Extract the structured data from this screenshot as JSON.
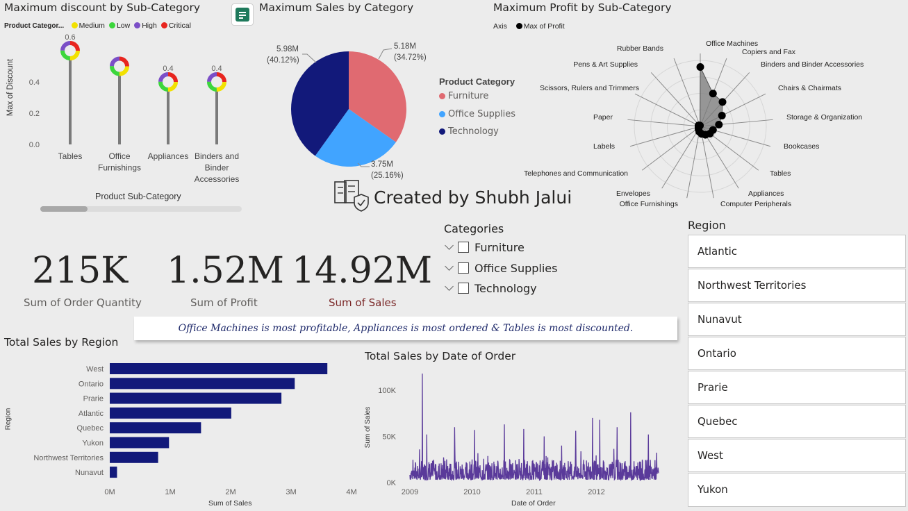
{
  "discount_chart": {
    "title": "Maximum discount by Sub-Category",
    "legend_title": "Product Categor...",
    "legend": [
      {
        "label": "Medium",
        "color": "#f2e100"
      },
      {
        "label": "Low",
        "color": "#3cd63c"
      },
      {
        "label": "High",
        "color": "#7b4fc7"
      },
      {
        "label": "Critical",
        "color": "#e8251f"
      }
    ],
    "ylabel": "Max of Discount",
    "xlabel": "Product Sub-Category",
    "yticks": [
      "0.0",
      "0.2",
      "0.4"
    ]
  },
  "sales_category_chart": {
    "title": "Maximum Sales by Category",
    "legend_title": "Product Category",
    "slice_labels": [
      {
        "value": "5.18M",
        "pct": "(34.72%)"
      },
      {
        "value": "3.75M",
        "pct": "(25.16%)"
      },
      {
        "value": "5.98M",
        "pct": "(40.12%)"
      }
    ]
  },
  "profit_chart": {
    "title": "Maximum Profit by Sub-Category",
    "legend_axis": "Axis",
    "legend_series": "Max of Profit"
  },
  "credit": {
    "text": "Created by Shubh Jalui"
  },
  "kpis": [
    {
      "value": "215K",
      "label": "Sum of Order Quantity"
    },
    {
      "value": "1.52M",
      "label": "Sum of Profit"
    },
    {
      "value": "14.92M",
      "label": "Sum of Sales"
    }
  ],
  "categories_slicer": {
    "title": "Categories",
    "items": [
      "Furniture",
      "Office Supplies",
      "Technology"
    ]
  },
  "region_slicer": {
    "title": "Region",
    "items": [
      "Atlantic",
      "Northwest Territories",
      "Nunavut",
      "Ontario",
      "Prarie",
      "Quebec",
      "West",
      "Yukon"
    ]
  },
  "insight": {
    "text": "Office Machines is most profitable, Appliances is most ordered & Tables is most discounted."
  },
  "region_chart": {
    "title": "Total Sales by Region",
    "xlabel": "Sum of Sales",
    "ylabel": "Region",
    "xticks": [
      "0M",
      "1M",
      "2M",
      "3M",
      "4M"
    ]
  },
  "date_chart": {
    "title": "Total Sales by Date of Order",
    "xlabel": "Date of Order",
    "ylabel": "Sum of Sales",
    "xticks": [
      "2009",
      "2010",
      "2011",
      "2012"
    ],
    "yticks": [
      "0K",
      "50K",
      "100K"
    ]
  },
  "chart_data": [
    {
      "type": "lollipop",
      "title": "Maximum discount by Sub-Category",
      "categories": [
        "Tables",
        "Office Furnishings",
        "Appliances",
        "Binders and Binder Accessories"
      ],
      "values": [
        0.6,
        0.5,
        0.4,
        0.4
      ],
      "data_labels": [
        "0.6",
        "",
        "0.4",
        "0.4"
      ],
      "ylim": [
        0,
        0.6
      ],
      "legend": [
        "Medium",
        "Low",
        "High",
        "Critical"
      ],
      "xlabel": "Product Sub-Category",
      "ylabel": "Max of Discount"
    },
    {
      "type": "pie",
      "title": "Maximum Sales by Category",
      "categories": [
        "Furniture",
        "Office Supplies",
        "Technology"
      ],
      "values": [
        5.18,
        3.75,
        5.98
      ],
      "percentages": [
        34.72,
        25.16,
        40.12
      ],
      "colors": [
        "#e06a71",
        "#41a4ff",
        "#12197a"
      ],
      "legend_title": "Product Category"
    },
    {
      "type": "radar",
      "title": "Maximum Profit by Sub-Category",
      "categories": [
        "Office Machines",
        "Copiers and Fax",
        "Binders and Binder Accessories",
        "Chairs & Chairmats",
        "Storage & Organization",
        "Bookcases",
        "Tables",
        "Appliances",
        "Computer Peripherals",
        "Office Furnishings",
        "Envelopes",
        "Telephones and Communication",
        "Labels",
        "Paper",
        "Scissors, Rulers and Trimmers",
        "Pens & Art Supplies",
        "Rubber Bands"
      ],
      "values": [
        27000,
        16000,
        15000,
        11000,
        8500,
        6000,
        5500,
        4500,
        3500,
        2500,
        1500,
        1000,
        700,
        800,
        900,
        600,
        400
      ],
      "series": "Max of Profit"
    },
    {
      "type": "bar",
      "orientation": "horizontal",
      "title": "Total Sales by Region",
      "categories": [
        "West",
        "Ontario",
        "Prarie",
        "Atlantic",
        "Quebec",
        "Yukon",
        "Northwest Territories",
        "Nunavut"
      ],
      "values": [
        3.6,
        3.06,
        2.84,
        2.01,
        1.51,
        0.98,
        0.8,
        0.12
      ],
      "xlim": [
        0,
        4
      ],
      "unit": "M",
      "xlabel": "Sum of Sales",
      "ylabel": "Region",
      "color": "#12197a"
    },
    {
      "type": "line",
      "title": "Total Sales by Date of Order",
      "x_range": [
        "2009-01-01",
        "2012-12-31"
      ],
      "ylim": [
        0,
        120000
      ],
      "peaks": [
        {
          "x": "2009-03-15",
          "y": 118000
        },
        {
          "x": "2009-04-10",
          "y": 52000
        },
        {
          "x": "2009-09-20",
          "y": 60000
        },
        {
          "x": "2010-01-15",
          "y": 57000
        },
        {
          "x": "2010-07-10",
          "y": 63000
        },
        {
          "x": "2010-11-01",
          "y": 58000
        },
        {
          "x": "2011-03-01",
          "y": 50000
        },
        {
          "x": "2011-09-01",
          "y": 56000
        },
        {
          "x": "2011-12-10",
          "y": 70000
        },
        {
          "x": "2012-01-20",
          "y": 68000
        },
        {
          "x": "2012-05-01",
          "y": 60000
        },
        {
          "x": "2012-07-20",
          "y": 76000
        },
        {
          "x": "2012-11-01",
          "y": 52000
        }
      ],
      "baseline_range": [
        3000,
        25000
      ],
      "color": "#5a3a9a",
      "xlabel": "Date of Order",
      "ylabel": "Sum of Sales"
    }
  ]
}
